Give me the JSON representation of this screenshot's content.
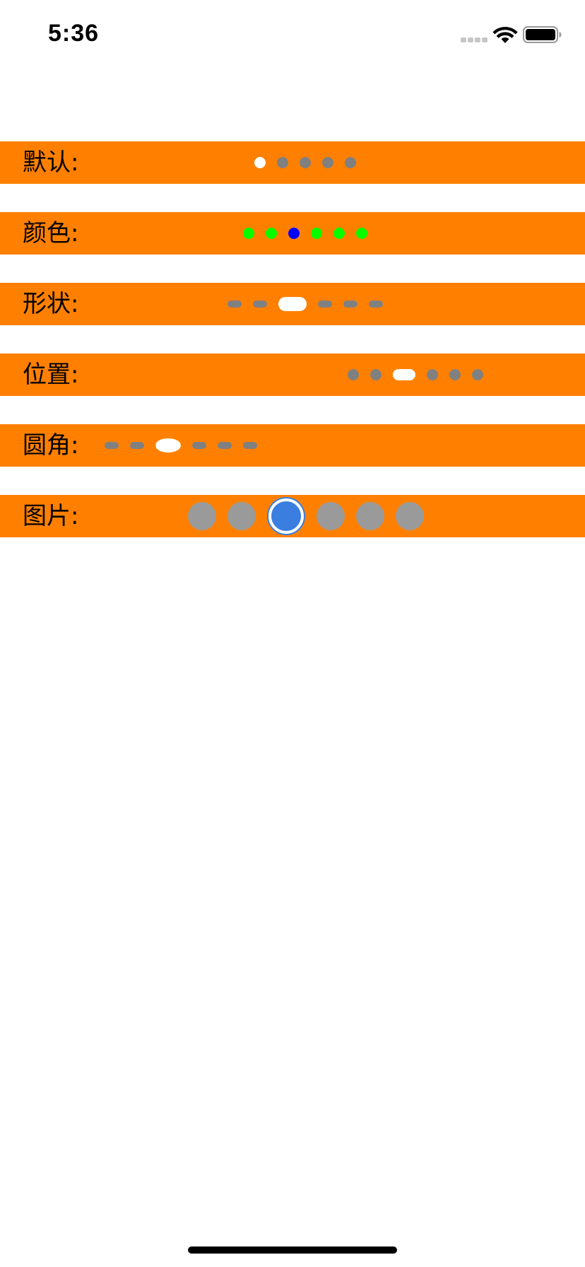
{
  "status_bar": {
    "time": "5:36",
    "signal_icon": "cellular-signal-dots-icon",
    "wifi_icon": "wifi-icon",
    "battery_icon": "battery-full-icon"
  },
  "colors": {
    "row_background": "#ff8000",
    "dot_inactive": "#808080",
    "dot_active": "#ffffff",
    "color_inactive": "#00ff00",
    "color_active": "#0000ff",
    "image_inactive": "#9a9a9a",
    "image_active": "#3a7fe0"
  },
  "rows": [
    {
      "key": "default",
      "label": "默认:",
      "count": 5,
      "current": 1
    },
    {
      "key": "color",
      "label": "颜色:",
      "count": 6,
      "current": 3
    },
    {
      "key": "shape",
      "label": "形状:",
      "count": 6,
      "current": 3
    },
    {
      "key": "position",
      "label": "位置:",
      "count": 6,
      "current": 3
    },
    {
      "key": "corner",
      "label": "圆角:",
      "count": 6,
      "current": 3
    },
    {
      "key": "image",
      "label": "图片:",
      "count": 6,
      "current": 3
    }
  ]
}
